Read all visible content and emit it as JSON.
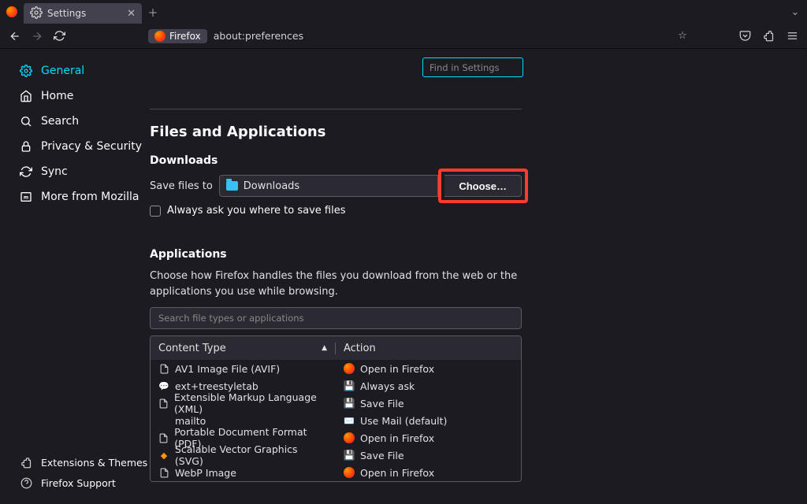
{
  "window": {
    "tab_title": "Settings",
    "url_badge": "Firefox",
    "url": "about:preferences"
  },
  "settings_search": {
    "placeholder": "Find in Settings"
  },
  "sidebar": {
    "items": [
      {
        "label": "General"
      },
      {
        "label": "Home"
      },
      {
        "label": "Search"
      },
      {
        "label": "Privacy & Security"
      },
      {
        "label": "Sync"
      },
      {
        "label": "More from Mozilla"
      }
    ],
    "footer": [
      {
        "label": "Extensions & Themes"
      },
      {
        "label": "Firefox Support"
      }
    ]
  },
  "section": {
    "title": "Files and Applications",
    "downloads": {
      "heading": "Downloads",
      "save_label": "Save files to",
      "path": "Downloads",
      "choose": "Choose…",
      "always_ask": "Always ask you where to save files"
    },
    "applications": {
      "heading": "Applications",
      "description": "Choose how Firefox handles the files you download from the web or the applications you use while browsing.",
      "search_placeholder": "Search file types or applications",
      "col_type": "Content Type",
      "col_action": "Action",
      "rows": [
        {
          "type": "AV1 Image File (AVIF)",
          "action": "Open in Firefox",
          "ticon": "file",
          "aicon": "ff"
        },
        {
          "type": "ext+treestyletab",
          "action": "Always ask",
          "ticon": "ext",
          "aicon": "disk"
        },
        {
          "type": "Extensible Markup Language (XML)",
          "action": "Save File",
          "ticon": "file",
          "aicon": "disk"
        },
        {
          "type": "mailto",
          "action": "Use Mail (default)",
          "ticon": "none",
          "aicon": "mail"
        },
        {
          "type": "Portable Document Format (PDF)",
          "action": "Open in Firefox",
          "ticon": "file",
          "aicon": "ff"
        },
        {
          "type": "Scalable Vector Graphics (SVG)",
          "action": "Save File",
          "ticon": "svg",
          "aicon": "disk"
        },
        {
          "type": "WebP Image",
          "action": "Open in Firefox",
          "ticon": "file",
          "aicon": "ff"
        }
      ]
    }
  }
}
